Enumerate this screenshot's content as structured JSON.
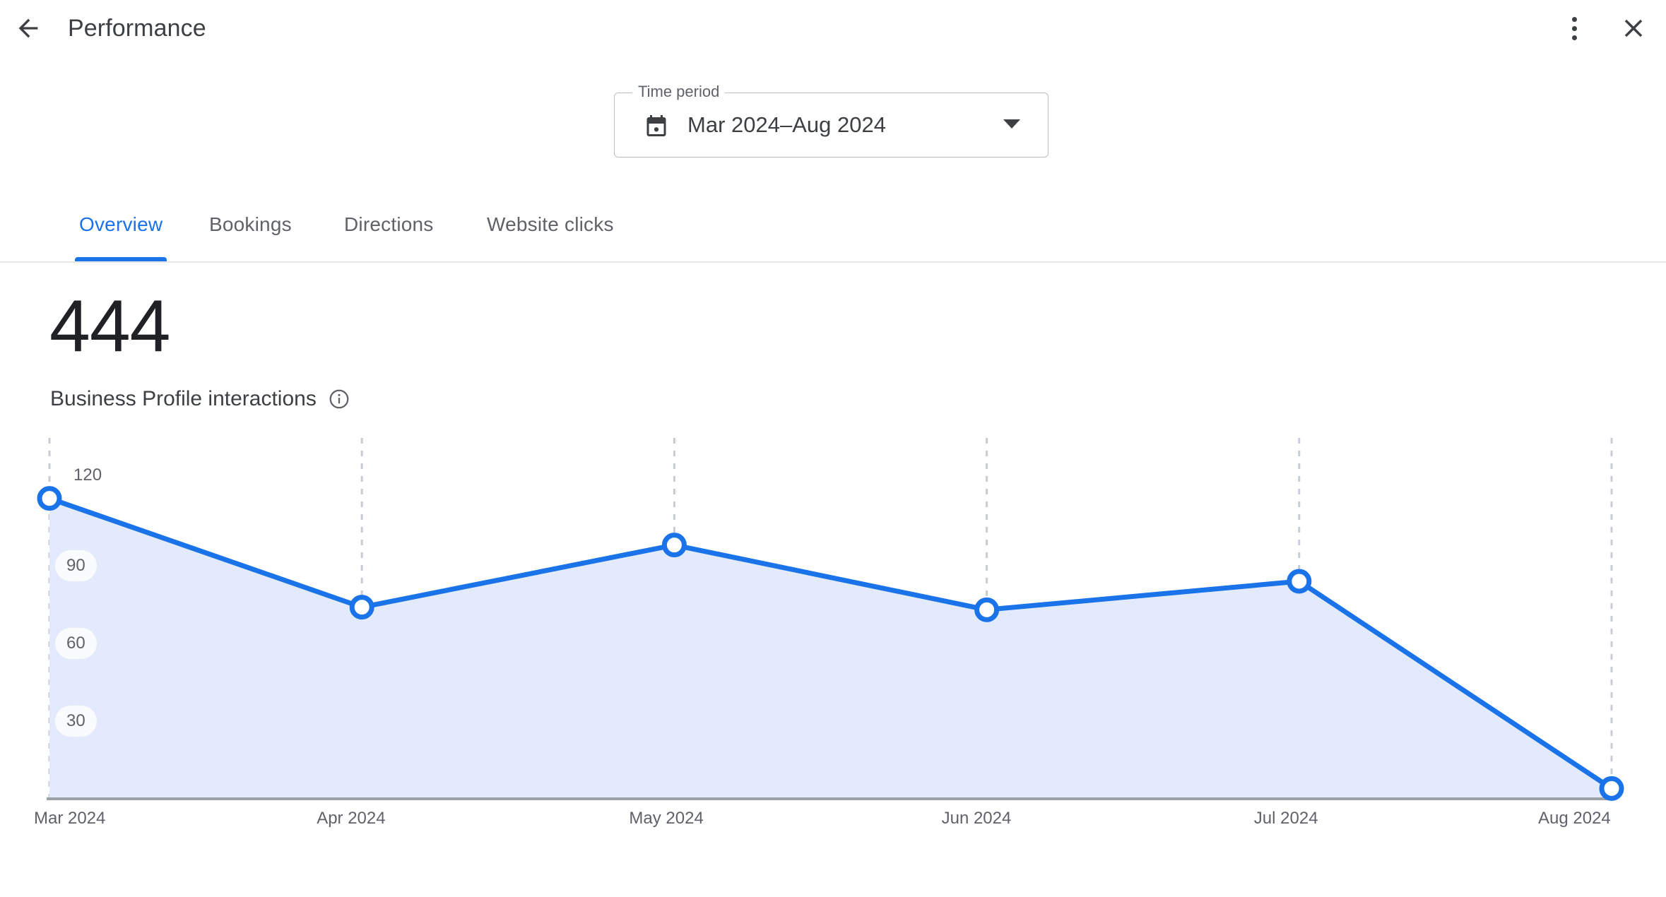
{
  "appbar": {
    "back_icon": "arrow-back-icon",
    "title": "Performance",
    "more_icon": "more-vert-icon",
    "close_icon": "close-icon"
  },
  "time_period": {
    "legend": "Time period",
    "value": "Mar 2024–Aug 2024",
    "calendar_icon": "calendar-icon",
    "dropdown_icon": "chevron-down-icon"
  },
  "tabs": [
    {
      "label": "Overview",
      "active": true
    },
    {
      "label": "Bookings",
      "active": false
    },
    {
      "label": "Directions",
      "active": false
    },
    {
      "label": "Website clicks",
      "active": false
    }
  ],
  "summary": {
    "total": "444",
    "label": "Business Profile interactions",
    "info_icon": "info-icon"
  },
  "colors": {
    "accent": "#1a73e8",
    "area_fill": "#e3eafb",
    "text_primary": "#202124",
    "text_secondary": "#5f6368",
    "gridline": "#c8ccd4",
    "axis": "#9aa0a6"
  },
  "chart_data": {
    "type": "area",
    "title": "Business Profile interactions",
    "xlabel": "",
    "ylabel": "",
    "x": [
      "Mar 2024",
      "Apr 2024",
      "May 2024",
      "Jun 2024",
      "Jul 2024",
      "Aug 2024"
    ],
    "series": [
      {
        "name": "Business Profile interactions",
        "values": [
          116,
          74,
          98,
          73,
          84,
          4
        ]
      }
    ],
    "ytick_labels": [
      "120",
      "90",
      "60",
      "30"
    ],
    "ytick_values": [
      120,
      90,
      60,
      30
    ],
    "ylim": [
      0,
      130
    ],
    "grid": "vertical-dashed",
    "legend": "none",
    "markers": "open-circle"
  }
}
